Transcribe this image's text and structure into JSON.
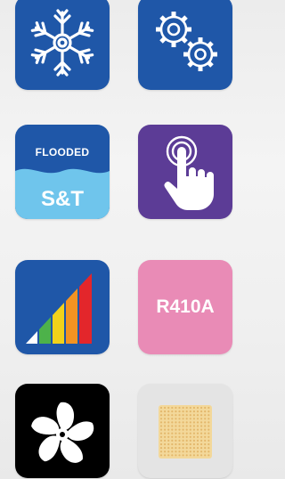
{
  "tiles": {
    "snowflake": {
      "icon": "snowflake-icon",
      "color": "#1f57a8"
    },
    "settings": {
      "icon": "gears-icon",
      "color": "#1f57a8"
    },
    "flooded": {
      "top_label": "FLOODED",
      "bottom_label": "S&T",
      "color": "#1f57a8",
      "wave_color": "#6fc5ec"
    },
    "touch": {
      "icon": "touch-finger-icon",
      "color": "#5c3c96"
    },
    "efficiency": {
      "icon": "efficiency-bars-icon",
      "color": "#1f57a8"
    },
    "refrigerant": {
      "label": "R410A",
      "color": "#e98bb6"
    },
    "fan": {
      "icon": "fan-icon",
      "color": "#000000"
    },
    "filter": {
      "icon": "filter-grid-icon",
      "color": "#e4e4e4",
      "grid_color": "#f3d89a"
    }
  }
}
